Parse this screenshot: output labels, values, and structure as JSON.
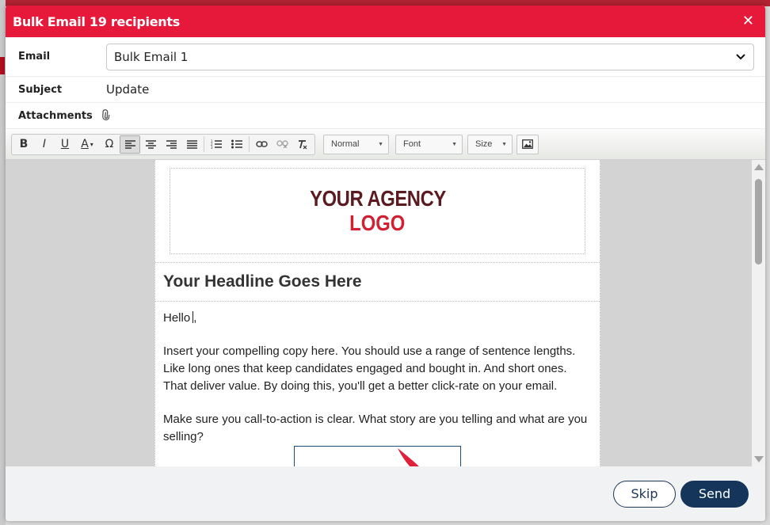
{
  "modal": {
    "title": "Bulk Email 19 recipients",
    "close_icon": "close-icon"
  },
  "form": {
    "email_label": "Email",
    "email_selected": "Bulk Email 1",
    "subject_label": "Subject",
    "subject_value": "Update",
    "attachments_label": "Attachments",
    "attachment_icon": "paperclip-icon"
  },
  "toolbar": {
    "buttons": [
      "bold",
      "italic",
      "underline",
      "text-color",
      "special-character",
      "align-left",
      "align-center",
      "align-right",
      "justify",
      "numbered-list",
      "bulleted-list",
      "link",
      "unlink",
      "remove-format"
    ],
    "bold": "B",
    "italic": "I",
    "underline": "U",
    "text_color": "A",
    "special_char": "Ω",
    "format_combo": "Normal",
    "font_combo": "Font",
    "size_combo": "Size",
    "image_icon": "image-icon"
  },
  "email_content": {
    "logo_line1": "YOUR AGENCY",
    "logo_line2": "LOGO",
    "headline": "Your Headline Goes Here",
    "greeting": "Hello",
    "greeting_punct": ",",
    "paragraph1": "Insert your compelling copy here. You should use a range of sentence lengths. Like long ones that keep candidates engaged and bought in. And short ones. That deliver value. By doing this, you'll get a better click-rate on your email.",
    "paragraph2": "Make sure you call-to-action is clear. What story are you telling and what are you selling?"
  },
  "footer": {
    "skip_label": "Skip",
    "send_label": "Send"
  },
  "colors": {
    "header_red": "#e6193b",
    "send_navy": "#15355a",
    "logo_red": "#d21f32",
    "logo_dark": "#5a1a1f"
  }
}
